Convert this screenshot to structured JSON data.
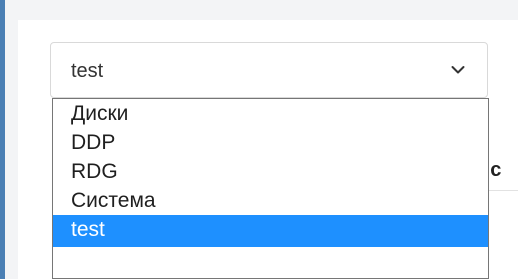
{
  "select": {
    "current_value": "test",
    "options": [
      {
        "label": "Диски"
      },
      {
        "label": "DDP"
      },
      {
        "label": "RDG"
      },
      {
        "label": "Система"
      },
      {
        "label": "test"
      }
    ],
    "selected_index": 4,
    "highlight_color": "#1e90ff"
  },
  "background": {
    "header_fragment": "йс"
  }
}
